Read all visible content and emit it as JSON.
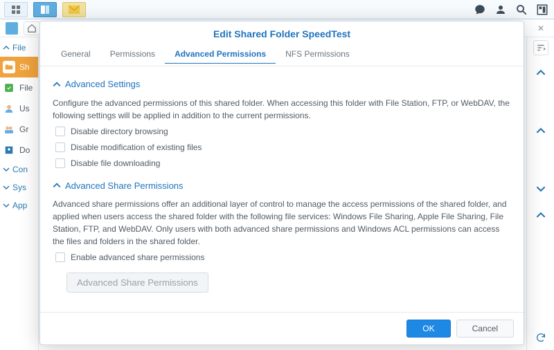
{
  "taskbar": {
    "items": [
      "grid",
      "browser",
      "mail"
    ]
  },
  "sidebar": {
    "group_file": "File",
    "items": [
      {
        "label": "Sh"
      },
      {
        "label": "File"
      },
      {
        "label": "Us"
      },
      {
        "label": "Gr"
      },
      {
        "label": "Do"
      }
    ],
    "group_con": "Con",
    "group_sys": "Sys",
    "group_app": "App"
  },
  "dialog": {
    "title": "Edit Shared Folder SpeedTest",
    "tabs": {
      "general": "General",
      "permissions": "Permissions",
      "advanced_perm": "Advanced Permissions",
      "nfs_perm": "NFS Permissions"
    },
    "sec1_title": "Advanced Settings",
    "sec1_desc": "Configure the advanced permissions of this shared folder. When accessing this folder with File Station, FTP, or WebDAV, the following settings will be applied in addition to the current permissions.",
    "chk1": "Disable directory browsing",
    "chk2": "Disable modification of existing files",
    "chk3": "Disable file downloading",
    "sec2_title": "Advanced Share Permissions",
    "sec2_desc": "Advanced share permissions offer an additional layer of control to manage the access permissions of the shared folder, and applied when users access the shared folder with the following file services: Windows File Sharing, Apple File Sharing, File Station, FTP, and WebDAV. Only users with both advanced share permissions and Windows ACL permissions can access the files and folders in the shared folder.",
    "chk4": "Enable advanced share permissions",
    "adv_btn": "Advanced Share Permissions",
    "ok": "OK",
    "cancel": "Cancel"
  }
}
